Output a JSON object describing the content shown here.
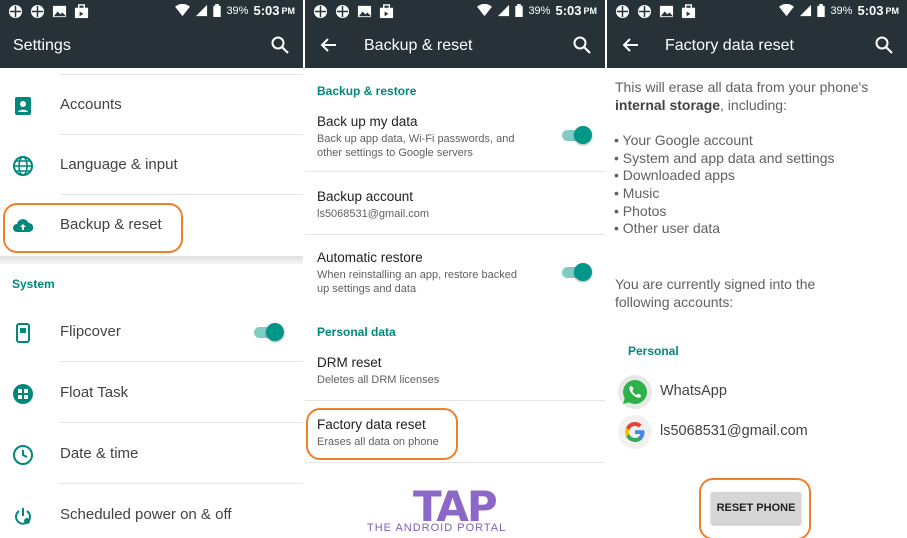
{
  "status_bar": {
    "battery": "39%",
    "time": "5:03",
    "ampm": "PM"
  },
  "settings": {
    "title": "Settings",
    "items_top": [
      {
        "label": "Accounts",
        "icon": "account-box-icon"
      },
      {
        "label": "Language & input",
        "icon": "globe-icon"
      },
      {
        "label": "Backup & reset",
        "icon": "cloud-upload-icon"
      }
    ],
    "section_system": "System",
    "items_system": [
      {
        "label": "Flipcover",
        "icon": "flipcover-icon",
        "toggle": true
      },
      {
        "label": "Float Task",
        "icon": "float-task-icon"
      },
      {
        "label": "Date & time",
        "icon": "clock-icon"
      },
      {
        "label": "Scheduled power on & off",
        "icon": "power-icon"
      }
    ]
  },
  "backup": {
    "title": "Backup & reset",
    "section_backup": "Backup & restore",
    "backup_my_data": {
      "title": "Back up my data",
      "summary_l1": "Back up app data, Wi-Fi passwords, and",
      "summary_l2": "other settings to Google servers",
      "on": true
    },
    "backup_account": {
      "title": "Backup account",
      "summary": "ls5068531@gmail.com"
    },
    "auto_restore": {
      "title": "Automatic restore",
      "summary_l1": "When reinstalling an app, restore backed",
      "summary_l2": "up settings and data",
      "on": true
    },
    "section_personal": "Personal data",
    "drm_reset": {
      "title": "DRM reset",
      "summary": "Deletes all DRM licenses"
    },
    "factory_reset": {
      "title": "Factory data reset",
      "summary": "Erases all data on phone"
    },
    "logo": {
      "main": "TAP",
      "sub": "THE ANDROID PORTAL"
    }
  },
  "factory": {
    "title": "Factory data reset",
    "intro_l1": "This will erase all data from your phone's",
    "intro_bold": "internal storage",
    "intro_rest": ", including:",
    "bullets": [
      "• Your Google account",
      "• System and app data and settings",
      "• Downloaded apps",
      "• Music",
      "• Photos",
      "• Other user data"
    ],
    "signed_l1": "You are currently signed into the",
    "signed_l2": "following accounts:",
    "section_personal": "Personal",
    "accounts": [
      {
        "label": "WhatsApp",
        "icon": "whatsapp-icon"
      },
      {
        "label": "ls5068531@gmail.com",
        "icon": "google-icon"
      }
    ],
    "reset_button": "RESET PHONE"
  },
  "colors": {
    "app_bar": "#263238",
    "accent": "#009688",
    "highlight": "#f07f2b"
  }
}
